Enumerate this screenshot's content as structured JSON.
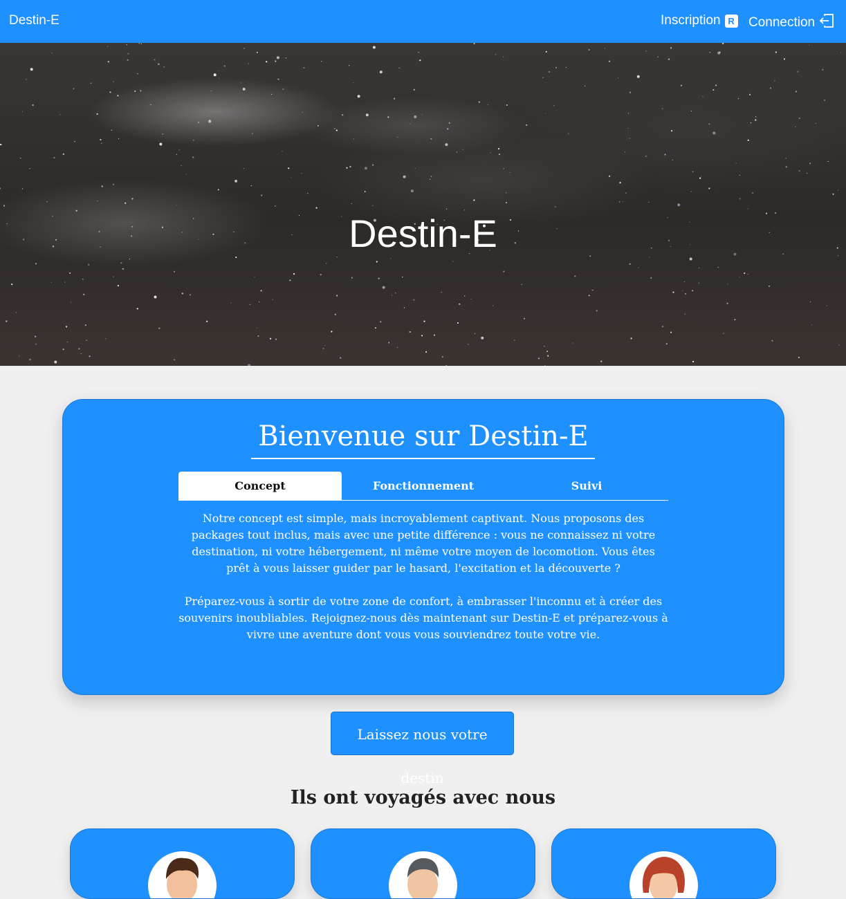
{
  "nav": {
    "brand": "Destin-E",
    "inscription_label": "Inscription",
    "inscription_icon_letter": "R",
    "connection_label": "Connection"
  },
  "hero": {
    "title": "Destin-E"
  },
  "welcome": {
    "title": "Bienvenue sur Destin-E",
    "tabs": [
      {
        "label": "Concept",
        "active": true
      },
      {
        "label": "Fonctionnement",
        "active": false
      },
      {
        "label": "Suivi",
        "active": false
      }
    ],
    "paragraphs": [
      "Notre concept est simple, mais incroyablement captivant. Nous proposons des packages tout inclus, mais avec une petite différence : vous ne connaissez ni votre destination, ni votre hébergement, ni même votre moyen de locomotion. Vous êtes prêt à vous laisser guider par le hasard, l'excitation et la découverte ?",
      "Préparez-vous à sortir de votre zone de confort, à embrasser l'inconnu et à créer des souvenirs inoubliables. Rejoignez-nous dès maintenant sur Destin-E et préparez-vous à vivre une aventure dont vous vous souviendrez toute votre vie."
    ]
  },
  "cta": {
    "label": "Laissez nous votre destin"
  },
  "testimonials": {
    "title": "Ils ont voyagés avec nous",
    "avatars": [
      "man-brown-hair-avatar",
      "man-gray-hair-avatar",
      "woman-red-hair-avatar"
    ]
  },
  "colors": {
    "primary": "#1e90ff",
    "background": "#f0f0f0",
    "text_dark": "#222222"
  }
}
